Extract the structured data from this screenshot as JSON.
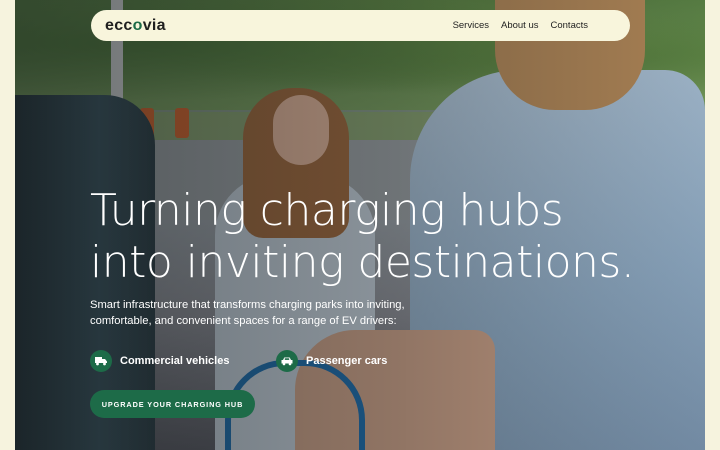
{
  "nav": {
    "logo": "eccovia",
    "links": [
      "Services",
      "About us",
      "Contacts"
    ]
  },
  "hero": {
    "headline": "Turning charging hubs\ninto inviting destinations.",
    "subheadline": "Smart infrastructure that transforms charging parks into inviting, comfortable, and convenient spaces for a range of EV drivers:",
    "features": [
      {
        "label": "Commercial vehicles",
        "icon": "truck-icon"
      },
      {
        "label": "Passenger cars",
        "icon": "car-icon"
      }
    ],
    "cta_label": "UPGRADE YOUR CHARGING HUB",
    "image_alt": "Photo of two people at an EV charging station"
  },
  "colors": {
    "brand_green": "#1d6b48",
    "nav_background": "#f8f5dc",
    "page_background": "#f6f3de"
  }
}
